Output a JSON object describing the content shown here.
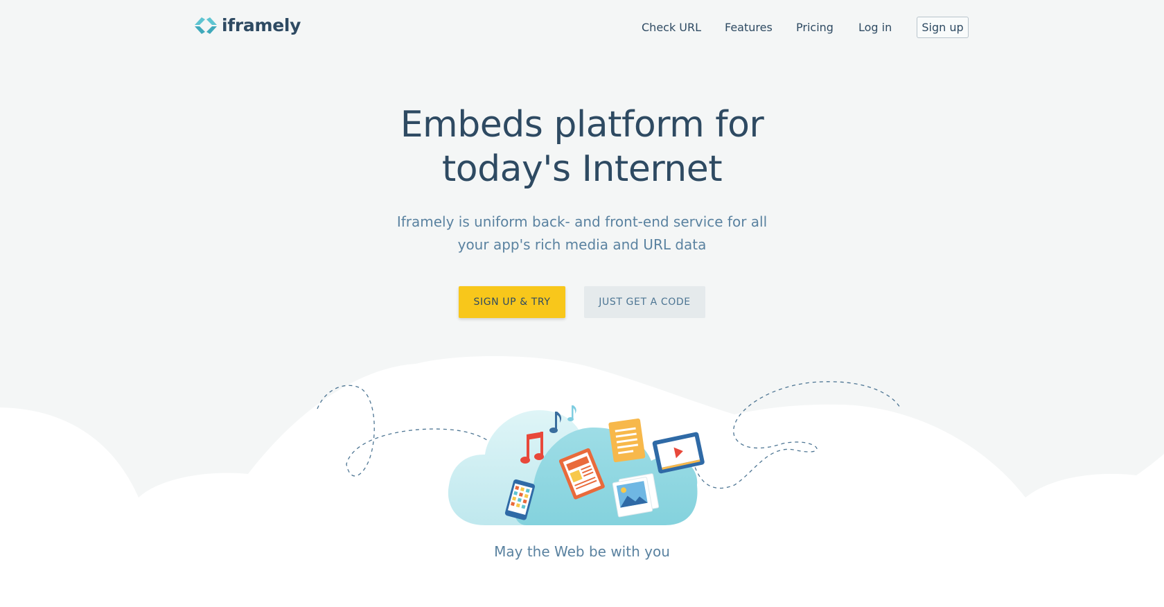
{
  "header": {
    "logo_text": "iframely",
    "nav": {
      "check_url": "Check URL",
      "features": "Features",
      "pricing": "Pricing",
      "login": "Log in",
      "signup": "Sign up"
    }
  },
  "hero": {
    "title_line1": "Embeds platform for",
    "title_line2": "today's Internet",
    "subtitle_line1": "Iframely is uniform back- and front-end service for all",
    "subtitle_line2": "your app's rich media and URL data",
    "primary_button": "SIGN UP & TRY",
    "secondary_button": "JUST GET A CODE"
  },
  "illustration": {
    "tagline": "May the Web be with you",
    "icons": [
      "music-note-icon",
      "document-icon",
      "video-player-icon",
      "newspaper-icon",
      "photo-icon",
      "phone-icon"
    ]
  },
  "colors": {
    "text": "#2e4a62",
    "subtitle": "#5a82a0",
    "primary_button": "#f8c71b",
    "secondary_button": "#e5eaec",
    "accent_teal": "#5ec4d1",
    "background": "#f4f6f6"
  }
}
